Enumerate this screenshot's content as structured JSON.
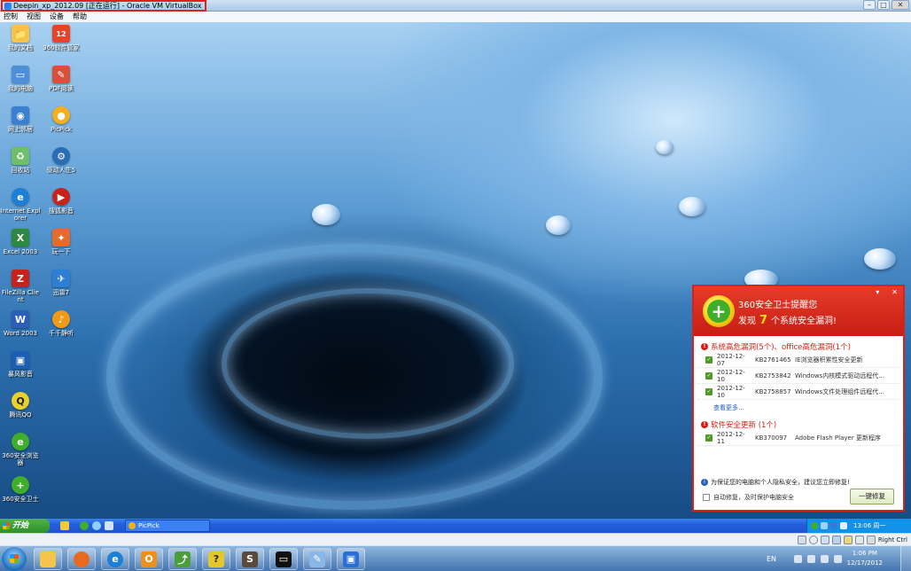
{
  "window": {
    "title": "Deepin_xp_2012.09 [正在运行] - Oracle VM VirtualBox",
    "controls": {
      "minimize": "–",
      "maximize": "□",
      "close": "✕"
    }
  },
  "vbox_menu": [
    "控制",
    "视图",
    "设备",
    "帮助"
  ],
  "desktop_icons": [
    {
      "label": "我的文档",
      "icon": "folder-icon",
      "color": "#f4c54a"
    },
    {
      "label": "360软件管家",
      "icon": "software-manager-icon",
      "color": "#e8432a",
      "badge": "12"
    },
    {
      "label": "我的电脑",
      "icon": "computer-icon",
      "color": "#4d8fd8"
    },
    {
      "label": "PDF阅读",
      "icon": "pdf-icon",
      "color": "#d9503a"
    },
    {
      "label": "网上邻居",
      "icon": "network-icon",
      "color": "#3b7fd0"
    },
    {
      "label": "PicPick",
      "icon": "picpick-icon",
      "color": "#f2b01e"
    },
    {
      "label": "回收站",
      "icon": "recycle-bin-icon",
      "color": "#6fbf6a"
    },
    {
      "label": "驱动人生5",
      "icon": "driver-icon",
      "color": "#2a6db5"
    },
    {
      "label": "Internet Explorer",
      "icon": "ie-icon",
      "color": "#1e7fd6"
    },
    {
      "label": "搜狐影音",
      "icon": "video-player-icon",
      "color": "#c8231a"
    },
    {
      "label": "Excel 2003",
      "icon": "excel-icon",
      "color": "#2d8a3c"
    },
    {
      "label": "玩一下",
      "icon": "game-icon",
      "color": "#e46b2a"
    },
    {
      "label": "FileZilla Client",
      "icon": "filezilla-icon",
      "color": "#c8231a"
    },
    {
      "label": "迅雷7",
      "icon": "thunder-icon",
      "color": "#2d7fd4"
    },
    {
      "label": "Word 2003",
      "icon": "word-icon",
      "color": "#2b5fb8"
    },
    {
      "label": "千千静听",
      "icon": "music-player-icon",
      "color": "#f09a1a"
    },
    {
      "label": "暴风影音",
      "icon": "storm-player-icon",
      "color": "#1d5fb5"
    },
    {
      "label": "腾讯QQ",
      "icon": "qq-icon",
      "color": "#e9d02c"
    },
    {
      "label": "360安全浏览器",
      "icon": "360-browser-icon",
      "color": "#3fae2a"
    },
    {
      "label": "360安全卫士",
      "icon": "360-guard-icon",
      "color": "#3fae2a"
    }
  ],
  "popup": {
    "title": "360安全卫士提醒您",
    "msg_before": "发现",
    "count": "7",
    "msg_after": "个系统安全漏洞!",
    "controls": {
      "minimize": "▾",
      "close": "✕"
    },
    "section1": "系统高危漏洞(5个)、office高危漏洞(1个)",
    "rows1": [
      {
        "date": "2012-12-07",
        "kb": "KB2761465",
        "desc": "IE浏览器积累性安全更新"
      },
      {
        "date": "2012-12-10",
        "kb": "KB2753842",
        "desc": "Windows内核模式驱动远程代..."
      },
      {
        "date": "2012-12-10",
        "kb": "KB2758857",
        "desc": "Windows文件处理组件远程代..."
      }
    ],
    "more": "查看更多...",
    "section2": "软件安全更新 (1个)",
    "rows2": [
      {
        "date": "2012-12-11",
        "kb": "KB370097",
        "desc": "Adobe Flash Player 更新程序"
      }
    ],
    "note": "为保证您的电脑和个人隐私安全，建议您立即修复!",
    "auto_fix": "自动修复，及时保护电脑安全",
    "fix_button": "一键修复"
  },
  "xp_taskbar": {
    "start": "开始",
    "task": "PicPick",
    "clock": "13:06 周一"
  },
  "vbox_status": {
    "host_key": "Right Ctrl"
  },
  "host_taskbar": {
    "lang": "EN",
    "time": "1:06 PM",
    "date": "12/17/2012"
  },
  "colors": {
    "accent_red": "#d8231a",
    "xp_blue": "#245edb",
    "green": "#3fae2a"
  }
}
